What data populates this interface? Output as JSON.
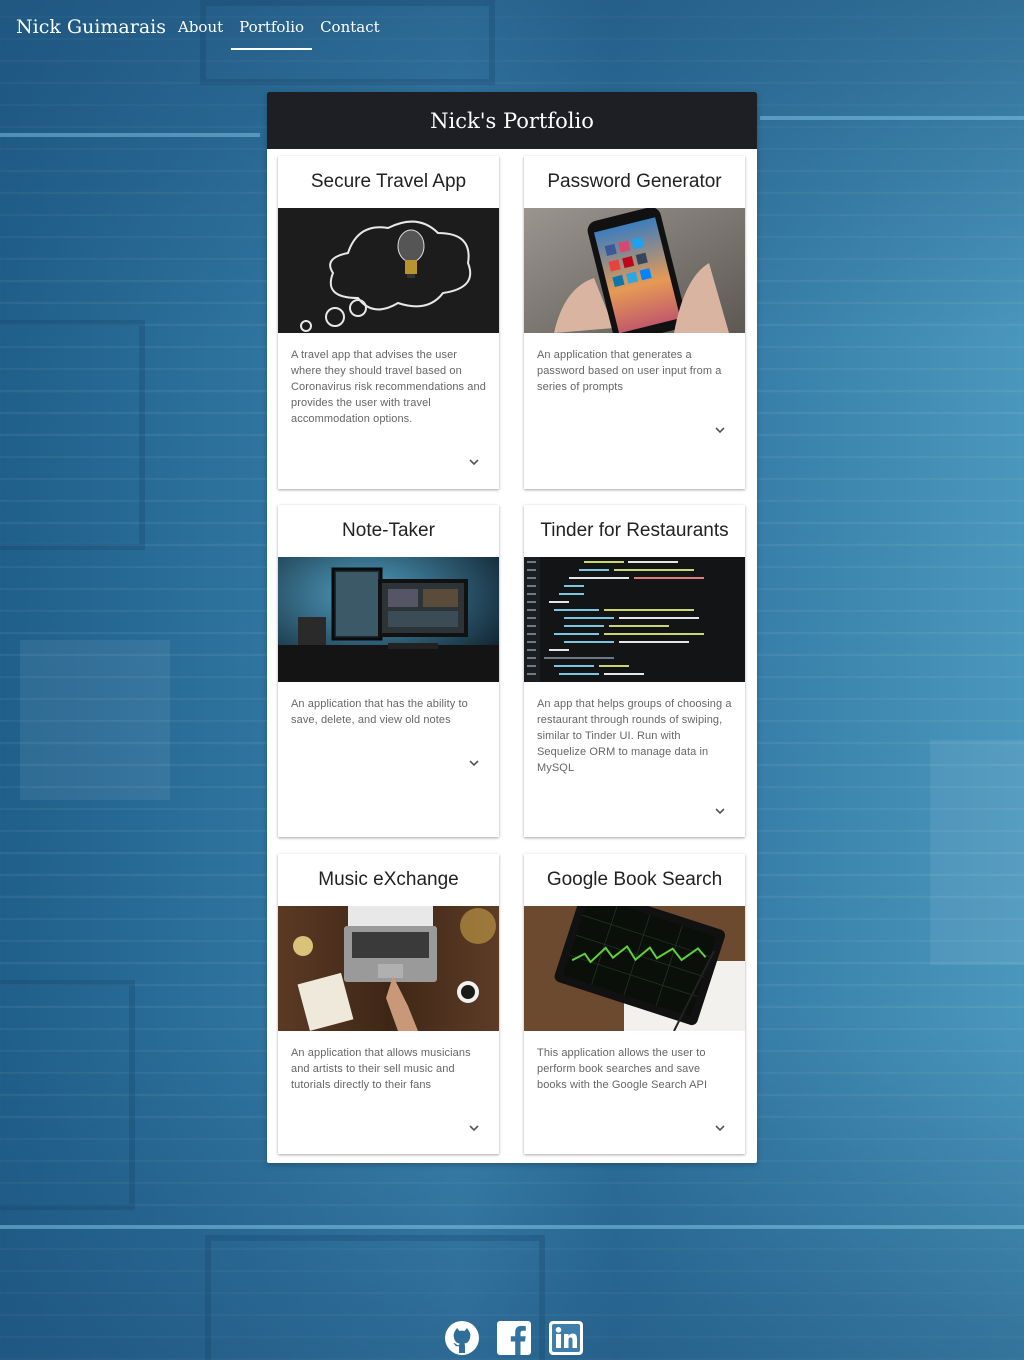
{
  "navbar": {
    "brand": "Nick Guimarais",
    "links": [
      {
        "label": "About",
        "active": false
      },
      {
        "label": "Portfolio",
        "active": true
      },
      {
        "label": "Contact",
        "active": false
      }
    ]
  },
  "portfolio": {
    "title": "Nick's Portfolio",
    "projects": [
      {
        "title": "Secure Travel App",
        "description": "A travel app that advises the user where they should travel based on Coronavirus risk recommendations and provides the user with travel accommodation options.",
        "image": "lightbulb-thought-bubble"
      },
      {
        "title": "Password Generator",
        "description": "An application that generates a password based on user input from a series of prompts",
        "image": "smartphone-social-apps"
      },
      {
        "title": "Note-Taker",
        "description": "An application that has the ability to save, delete, and view old notes",
        "image": "desk-monitor-setup"
      },
      {
        "title": "Tinder for Restaurants",
        "description": "An app that helps groups of choosing a restaurant through rounds of swiping, similar to Tinder UI. Run with Sequelize ORM to manage data in MySQL",
        "image": "code-editor-screen"
      },
      {
        "title": "Music eXchange",
        "description": "An application that allows musicians and artists to their sell music and tutorials directly to their fans",
        "image": "laptop-desk-workspace"
      },
      {
        "title": "Google Book Search",
        "description": "This application allows the user to perform book searches and save books with the Google Search API",
        "image": "tablet-stock-chart"
      }
    ]
  },
  "footer": {
    "icons": [
      "github-icon",
      "facebook-icon",
      "linkedin-icon"
    ]
  }
}
